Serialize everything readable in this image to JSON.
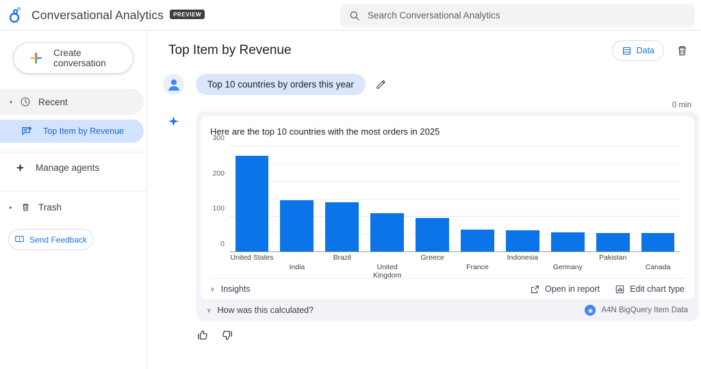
{
  "header": {
    "logo_icon": "conversational-analytics-logo",
    "app_title": "Conversational Analytics",
    "preview_badge": "PREVIEW",
    "search": {
      "icon": "search-icon",
      "placeholder": "Search Conversational Analytics"
    }
  },
  "sidebar": {
    "create_button": {
      "label": "Create conversation",
      "icon": "plus-icon"
    },
    "recent": {
      "label": "Recent",
      "icon": "clock-icon",
      "caret": "▾"
    },
    "conversations": [
      {
        "label": "Top Item by Revenue",
        "icon": "conversation-icon",
        "selected": true
      }
    ],
    "manage_agents": {
      "label": "Manage agents",
      "icon": "sparkle-icon"
    },
    "trash": {
      "label": "Trash",
      "icon": "trash-icon",
      "caret": "▸"
    },
    "send_feedback": {
      "label": "Send Feedback",
      "icon": "feedback-icon"
    }
  },
  "main": {
    "page_title": "Top Item by Revenue",
    "data_button": {
      "label": "Data",
      "icon": "table-icon"
    },
    "delete_button": {
      "icon": "trash-icon"
    },
    "user_message": {
      "avatar_icon": "user-avatar-icon",
      "text": "Top 10 countries by orders this year",
      "edit_icon": "pencil-icon"
    },
    "elapsed": "0 min",
    "assistant": {
      "icon": "sparkle-icon",
      "text": "Here are the top 10 countries with the most orders in 2025"
    },
    "chart_footer": {
      "insights": {
        "label": "Insights",
        "chevron": "∨"
      },
      "open_in_report": {
        "label": "Open in report",
        "icon": "external-link-icon"
      },
      "edit_chart_type": {
        "label": "Edit chart type",
        "icon": "bar-chart-icon"
      }
    },
    "calculated_row": {
      "label": "How was this calculated?",
      "chevron": "∨",
      "source": {
        "label": "A4N BigQuery Item Data",
        "icon": "bigquery-icon"
      }
    },
    "rating": {
      "up_icon": "thumb-up-icon",
      "down_icon": "thumb-down-icon"
    }
  },
  "colors": {
    "bar": "#0a74e8",
    "accent": "#1a73e8",
    "selected_bg": "#d3e3fd",
    "card_bg": "#f1f3f8"
  },
  "chart_data": {
    "type": "bar",
    "title": "Here are the top 10 countries with the most orders in 2025",
    "xlabel": "",
    "ylabel": "",
    "ylim": [
      0,
      300
    ],
    "yticks": [
      0,
      100,
      200,
      300
    ],
    "minor_ticks": [
      50,
      150,
      250
    ],
    "grid": true,
    "legend": false,
    "categories": [
      "United States",
      "India",
      "Brazil",
      "United Kingdom",
      "Greece",
      "France",
      "Indonesia",
      "Germany",
      "Pakistan",
      "Canada"
    ],
    "values": [
      272,
      147,
      141,
      110,
      95,
      63,
      60,
      54,
      53,
      52
    ]
  }
}
